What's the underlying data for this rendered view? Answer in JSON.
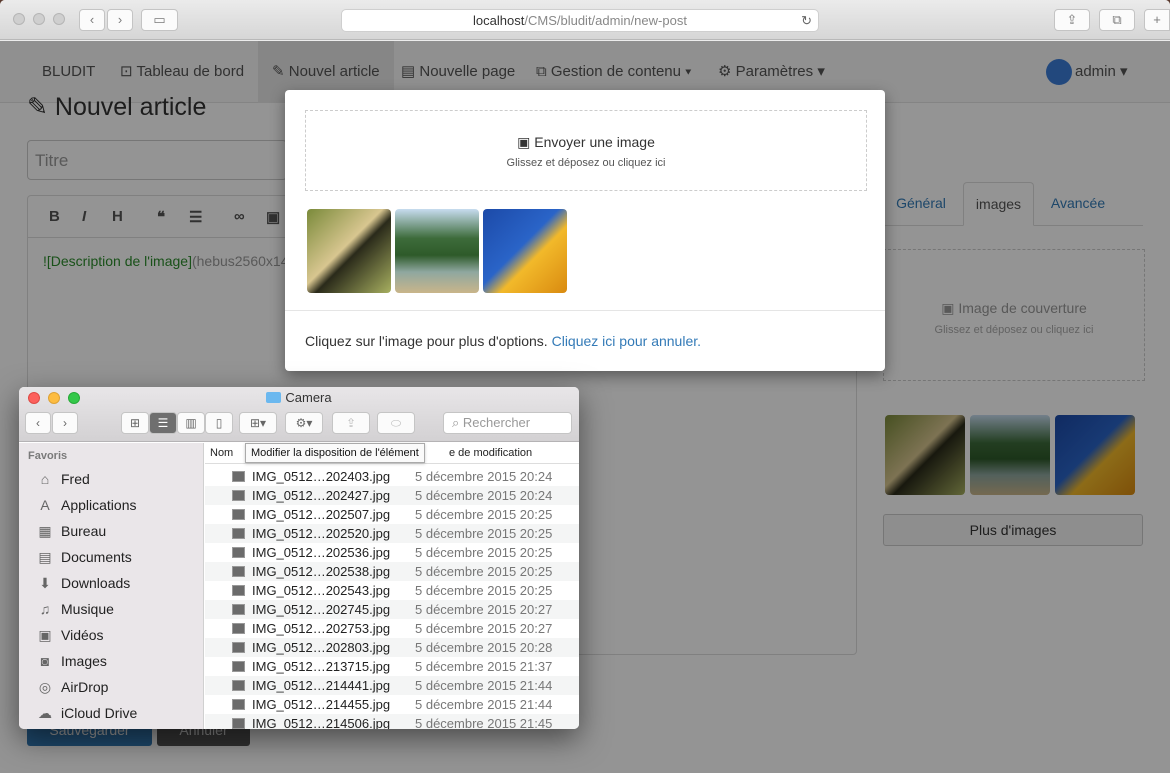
{
  "browser": {
    "url_host": "localhost",
    "url_path": "/CMS/bludit/admin/new-post"
  },
  "navbar": {
    "brand": "BLUDIT",
    "items": [
      {
        "label": "Tableau de bord",
        "icon": "dashboard-icon"
      },
      {
        "label": "Nouvel article",
        "icon": "pencil-icon"
      },
      {
        "label": "Nouvelle page",
        "icon": "file-icon"
      },
      {
        "label": "Gestion de contenu ▾",
        "icon": "copy-icon"
      },
      {
        "label": "Paramètres ▾",
        "icon": "gear-icon"
      }
    ],
    "user": "admin ▾"
  },
  "page": {
    "title": "Nouvel article",
    "title_placeholder": "Titre",
    "markdown_alt": "![Description de l'image]",
    "markdown_url": "(hebus2560x14",
    "save_label": "Sauvegarder",
    "cancel_label": "Annuler"
  },
  "sidebar_tabs": [
    {
      "label": "Général"
    },
    {
      "label": "images"
    },
    {
      "label": "Avancée"
    }
  ],
  "cover": {
    "title": "Image de couverture",
    "subtitle": "Glissez et déposez ou cliquez ici"
  },
  "more_images_label": "Plus d'images",
  "modal": {
    "drop_title": "Envoyer une image",
    "drop_subtitle": "Glissez et déposez ou cliquez ici",
    "footer_text": "Cliquez sur l'image pour plus d'options.",
    "footer_link": "Cliquez ici pour annuler."
  },
  "finder": {
    "title": "Camera",
    "search_placeholder": "Rechercher",
    "sidebar_header": "Favoris",
    "sidebar_items": [
      {
        "label": "Fred",
        "icon": "home-icon"
      },
      {
        "label": "Applications",
        "icon": "applications-icon"
      },
      {
        "label": "Bureau",
        "icon": "desktop-icon"
      },
      {
        "label": "Documents",
        "icon": "documents-icon"
      },
      {
        "label": "Downloads",
        "icon": "downloads-icon"
      },
      {
        "label": "Musique",
        "icon": "music-icon"
      },
      {
        "label": "Vidéos",
        "icon": "video-icon"
      },
      {
        "label": "Images",
        "icon": "camera-icon"
      },
      {
        "label": "AirDrop",
        "icon": "airdrop-icon"
      },
      {
        "label": "iCloud Drive",
        "icon": "cloud-icon"
      }
    ],
    "col_name": "Nom",
    "col_date": "e de modification",
    "tooltip": "Modifier la disposition de l'élément",
    "files": [
      {
        "name": "IMG_0512…202403.jpg",
        "date": "5 décembre 2015 20:24"
      },
      {
        "name": "IMG_0512…202427.jpg",
        "date": "5 décembre 2015 20:24"
      },
      {
        "name": "IMG_0512…202507.jpg",
        "date": "5 décembre 2015 20:25"
      },
      {
        "name": "IMG_0512…202520.jpg",
        "date": "5 décembre 2015 20:25"
      },
      {
        "name": "IMG_0512…202536.jpg",
        "date": "5 décembre 2015 20:25"
      },
      {
        "name": "IMG_0512…202538.jpg",
        "date": "5 décembre 2015 20:25"
      },
      {
        "name": "IMG_0512…202543.jpg",
        "date": "5 décembre 2015 20:25"
      },
      {
        "name": "IMG_0512…202745.jpg",
        "date": "5 décembre 2015 20:27"
      },
      {
        "name": "IMG_0512…202753.jpg",
        "date": "5 décembre 2015 20:27"
      },
      {
        "name": "IMG_0512…202803.jpg",
        "date": "5 décembre 2015 20:28"
      },
      {
        "name": "IMG_0512…213715.jpg",
        "date": "5 décembre 2015 21:37"
      },
      {
        "name": "IMG_0512…214441.jpg",
        "date": "5 décembre 2015 21:44"
      },
      {
        "name": "IMG_0512…214455.jpg",
        "date": "5 décembre 2015 21:44"
      },
      {
        "name": "IMG_0512…214506.jpg",
        "date": "5 décembre 2015 21:45"
      }
    ]
  }
}
